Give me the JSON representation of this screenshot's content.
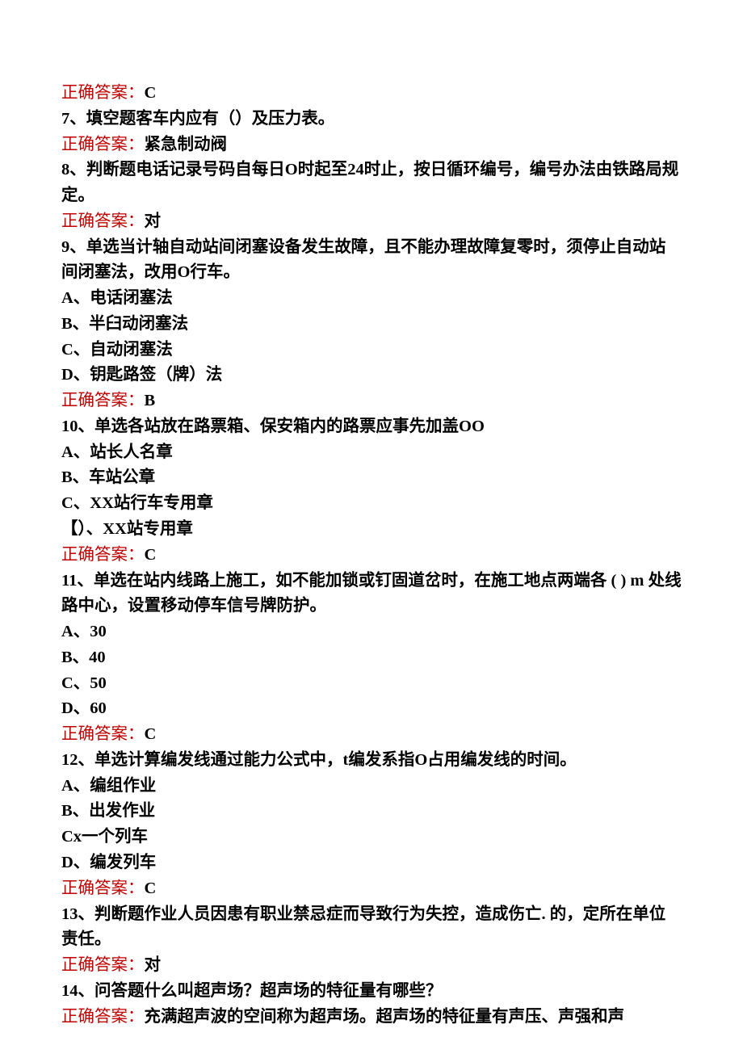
{
  "strings": {
    "answer_label": "正确答案：",
    "q6_ans": "C",
    "q7_text": "7、填空题客车内应有（）及压力表。",
    "q7_ans": "紧急制动阀",
    "q8_text": "8、判断题电话记录号码自每日O时起至24时止，按日循环编号，编号办法由铁路局规定。",
    "q8_ans": "对",
    "q9_text": "9、单选当计轴自动站间闭塞设备发生故障，且不能办理故障复零时，须停止自动站间闭塞法，改用O行车。",
    "q9_a": "A、电话闭塞法",
    "q9_b": "B、半臼动闭塞法",
    "q9_c": "C、自动闭塞法",
    "q9_d": "D、钥匙路签（牌）法",
    "q9_ans": "B",
    "q10_text": "10、单选各站放在路票箱、保安箱内的路票应事先加盖OO",
    "q10_a": "A、站长人名章",
    "q10_b": "B、车站公章",
    "q10_c": "C、XX站行车专用章",
    "q10_d": "【）、XX站专用章",
    "q10_ans": "C",
    "q11_text": "11、单选在站内线路上施工，如不能加锁或钉固道岔时，在施工地点两端各 ( ) m 处线路中心，设置移动停车信号牌防护。",
    "q11_a": "A、30",
    "q11_b": "B、40",
    "q11_c": "C、50",
    "q11_d": "D、60",
    "q11_ans": "C",
    "q12_text": "12、单选计算编发线通过能力公式中，t编发系指O占用编发线的时间。",
    "q12_a": "A、编组作业",
    "q12_b": "B、出发作业",
    "q12_c": "Cx一个列车",
    "q12_d": "D、编发列车",
    "q12_ans": "C",
    "q13_text": "13、判断题作业人员因患有职业禁忌症而导致行为失控，造成伤亡. 的，定所在单位责任。",
    "q13_ans": "对",
    "q14_text": "14、问答题什么叫超声场？超声场的特征量有哪些？",
    "q14_ans": "充满超声波的空间称为超声场。超声场的特征量有声压、声强和声"
  }
}
